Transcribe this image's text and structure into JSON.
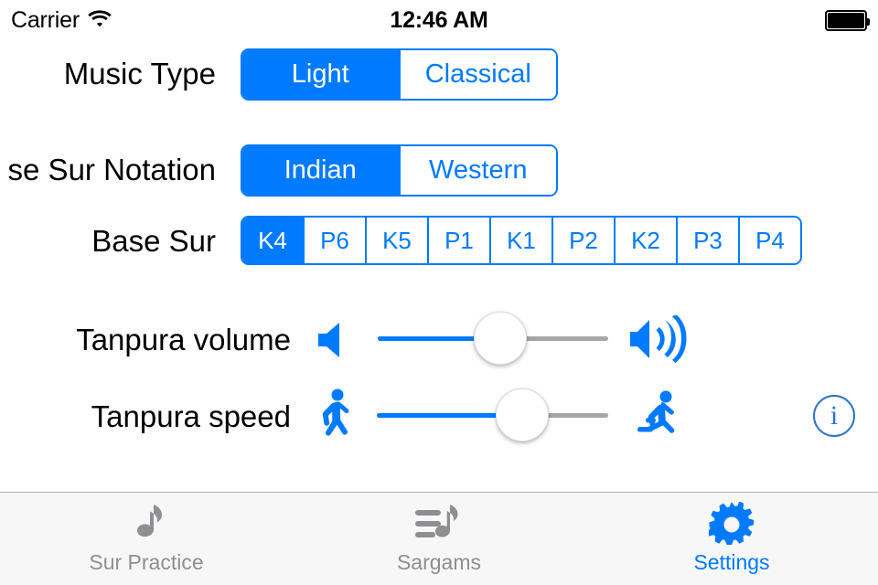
{
  "status_bar": {
    "carrier": "Carrier",
    "wifi_icon": "wifi-icon",
    "time": "12:46 AM",
    "battery_icon": "battery-full-icon"
  },
  "colors": {
    "accent_blue": "#007aff",
    "info_blue": "#2a72cc",
    "inactive_gray": "#8e8e93",
    "track_gray": "#a6a6a6",
    "tabbar_bg": "#f7f7f7"
  },
  "settings": {
    "music_type": {
      "label": "Music Type",
      "options": [
        "Light",
        "Classical"
      ],
      "selected_index": 0
    },
    "base_sur_notation": {
      "label": "Base Sur Notation",
      "label_visible": "se Sur Notation",
      "options": [
        "Indian",
        "Western"
      ],
      "selected_index": 0
    },
    "base_sur": {
      "label": "Base Sur",
      "options": [
        "K4",
        "P6",
        "K5",
        "P1",
        "K1",
        "P2",
        "K2",
        "P3",
        "P4"
      ],
      "selected_index": 0
    },
    "tanpura_volume": {
      "label": "Tanpura volume",
      "min_icon": "speaker-low-icon",
      "max_icon": "speaker-high-icon",
      "value_percent": 53
    },
    "tanpura_speed": {
      "label": "Tanpura speed",
      "min_icon": "walking-person-icon",
      "max_icon": "running-person-icon",
      "value_percent": 63
    },
    "info_button": {
      "glyph": "i",
      "icon": "info-circle-icon"
    }
  },
  "tab_bar": {
    "tabs": [
      {
        "label": "Sur Practice",
        "icon": "music-note-icon",
        "active": false
      },
      {
        "label": "Sargams",
        "icon": "music-list-icon",
        "active": false
      },
      {
        "label": "Settings",
        "icon": "gear-icon",
        "active": true
      }
    ]
  }
}
